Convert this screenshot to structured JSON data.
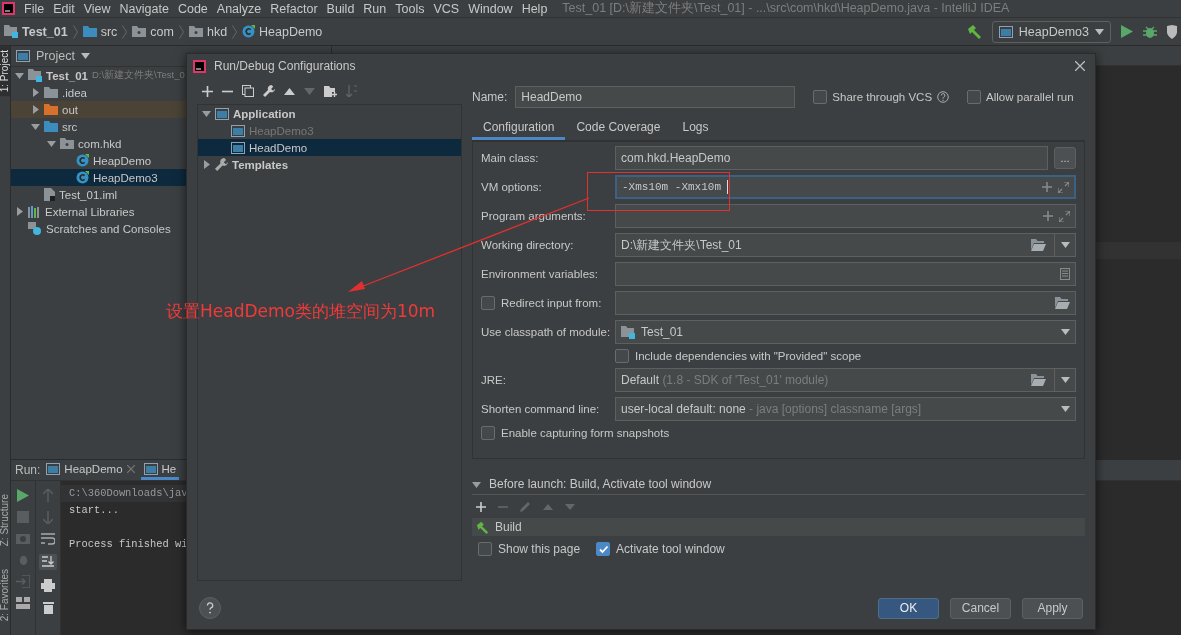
{
  "menu_bar": {
    "items": [
      "File",
      "Edit",
      "View",
      "Navigate",
      "Code",
      "Analyze",
      "Refactor",
      "Build",
      "Run",
      "Tools",
      "VCS",
      "Window",
      "Help"
    ],
    "title": "Test_01 [D:\\新建文件夹\\Test_01] - ...\\src\\com\\hkd\\HeapDemo.java - IntelliJ IDEA"
  },
  "nav_bar": {
    "breadcrumbs": [
      {
        "label": "Test_01",
        "kind": "module"
      },
      {
        "label": "src",
        "kind": "source"
      },
      {
        "label": "com",
        "kind": "package"
      },
      {
        "label": "hkd",
        "kind": "package"
      },
      {
        "label": "HeapDemo",
        "kind": "class"
      }
    ],
    "run_config": "HeapDemo3"
  },
  "side_stripe": {
    "tabs": [
      {
        "label": "1: Project",
        "selected": true
      },
      {
        "label": "Z: Structure",
        "selected": false
      },
      {
        "label": "2: Favorites",
        "selected": false
      }
    ]
  },
  "project_panel": {
    "title": "Project",
    "tree": [
      {
        "label": "Test_01",
        "path": "D:\\新建文件夹\\Test_0",
        "kind": "module",
        "expanded": true,
        "selected": false,
        "children": [
          {
            "label": ".idea",
            "kind": "folder",
            "expanded": false,
            "selected": false
          },
          {
            "label": "out",
            "kind": "excluded",
            "expanded": false,
            "selected": false
          },
          {
            "label": "src",
            "kind": "source",
            "expanded": true,
            "selected": false,
            "children": [
              {
                "label": "com.hkd",
                "kind": "package",
                "expanded": true,
                "selected": false,
                "children": [
                  {
                    "label": "HeapDemo",
                    "kind": "class",
                    "selected": false
                  },
                  {
                    "label": "HeapDemo3",
                    "kind": "class",
                    "selected": true
                  }
                ]
              }
            ]
          },
          {
            "label": "Test_01.iml",
            "kind": "file",
            "selected": false
          }
        ]
      },
      {
        "label": "External Libraries",
        "kind": "libraries",
        "expanded": false,
        "selected": false
      },
      {
        "label": "Scratches and Consoles",
        "kind": "scratches",
        "selected": false
      }
    ]
  },
  "run_panel": {
    "label": "Run:",
    "tabs": [
      {
        "label": "HeapDemo",
        "selected": false
      },
      {
        "label": "He",
        "selected": true
      }
    ],
    "console": [
      {
        "text": "C:\\360Downloads\\jav",
        "kind": "command"
      },
      {
        "text": "start...",
        "kind": "output"
      },
      {
        "text": "Process finished wi",
        "kind": "exit"
      }
    ]
  },
  "dialog": {
    "title": "Run/Debug Configurations",
    "tree": [
      {
        "label": "Application",
        "kind": "group",
        "expanded": true,
        "selected": false,
        "children": [
          {
            "label": "HeapDemo3",
            "kind": "config",
            "temporary": true,
            "selected": false
          },
          {
            "label": "HeadDemo",
            "kind": "config",
            "temporary": false,
            "selected": true
          }
        ]
      },
      {
        "label": "Templates",
        "kind": "templates",
        "expanded": false,
        "selected": false
      }
    ],
    "name": {
      "label": "Name:",
      "value": "HeadDemo"
    },
    "options": [
      {
        "label": "Share through VCS",
        "checked": false,
        "help": true
      },
      {
        "label": "Allow parallel run",
        "checked": false,
        "help": false
      }
    ],
    "tabs": [
      {
        "label": "Configuration",
        "selected": true
      },
      {
        "label": "Code Coverage",
        "selected": false
      },
      {
        "label": "Logs",
        "selected": false
      }
    ],
    "form": [
      {
        "kind": "class",
        "label": "Main class:",
        "value": "com.hkd.HeapDemo",
        "button": "..."
      },
      {
        "kind": "expand",
        "label": "VM options:",
        "value": "-Xms10m -Xmx10m",
        "focused": true
      },
      {
        "kind": "expand",
        "label": "Program arguments:",
        "focused": false
      },
      {
        "kind": "browse",
        "label": "Working directory:",
        "value": "D:\\新建文件夹\\Test_01"
      },
      {
        "kind": "env",
        "label": "Environment variables:"
      },
      {
        "kind": "redirect",
        "label": "Redirect input from:",
        "checked": false
      },
      {
        "kind": "module",
        "label": "Use classpath of module:",
        "value": "Test_01"
      },
      {
        "kind": "check",
        "label": "Include dependencies with \"Provided\" scope",
        "checked": false
      },
      {
        "kind": "jre",
        "label": "JRE:",
        "value": "Default",
        "hint": "(1.8 - SDK of 'Test_01' module)"
      },
      {
        "kind": "select",
        "label": "Shorten command line:",
        "value": "user-local default: none",
        "hint": "- java [options] classname [args]"
      },
      {
        "kind": "wide_check",
        "label": "Enable capturing form snapshots",
        "checked": false
      }
    ],
    "before_launch": {
      "title": "Before launch: Build, Activate tool window",
      "expanded": true,
      "tasks": [
        {
          "label": "Build"
        }
      ],
      "options": [
        {
          "label": "Show this page",
          "checked": false
        },
        {
          "label": "Activate tool window",
          "checked": true
        }
      ]
    },
    "buttons": [
      {
        "label": "OK",
        "kind": "primary"
      },
      {
        "label": "Cancel",
        "kind": "normal"
      },
      {
        "label": "Apply",
        "kind": "normal"
      }
    ]
  },
  "annotation": {
    "text": "设置HeadDemo类的堆空间为10m"
  }
}
